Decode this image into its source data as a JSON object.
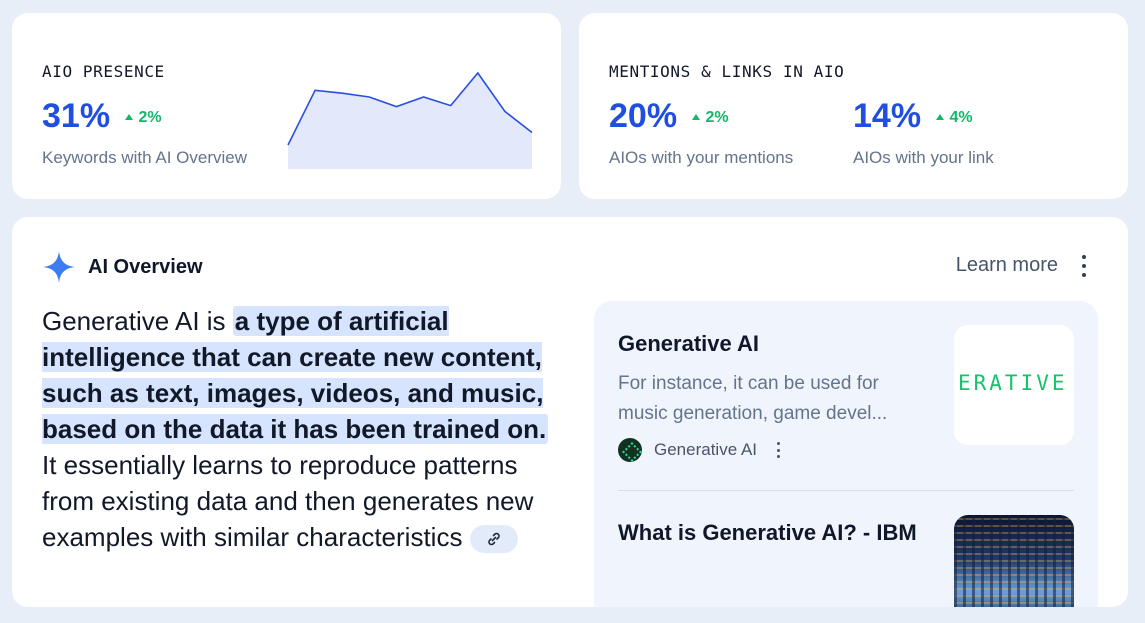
{
  "presence": {
    "title": "AIO PRESENCE",
    "value": "31%",
    "delta": "2%",
    "caption": "Keywords with AI Overview",
    "sparkline": [
      0.25,
      0.82,
      0.79,
      0.75,
      0.65,
      0.75,
      0.66,
      1.0,
      0.6,
      0.38
    ]
  },
  "mentions": {
    "title": "MENTIONS & LINKS IN AIO",
    "mentions_value": "20%",
    "mentions_delta": "2%",
    "mentions_caption": "AIOs with your mentions",
    "links_value": "14%",
    "links_delta": "4%",
    "links_caption": "AIOs with your link"
  },
  "overview": {
    "label": "AI Overview",
    "learn_more": "Learn more",
    "text_intro": "Generative AI is ",
    "text_highlight": "a type of artificial intelligence that can create new content, such as text, images, videos, and music, based on the data it has been trained on.",
    "text_rest": " It essentially learns to reproduce patterns from existing data and then generates new examples with similar characteristics",
    "sources": [
      {
        "title": "Generative AI",
        "description": "For instance, it can be used for music generation, game devel...",
        "site": "Generative AI",
        "thumb_text": "ERATIVE"
      },
      {
        "title": "What is Generative AI? - IBM"
      }
    ]
  },
  "colors": {
    "accent": "#1f4ee0",
    "positive": "#12b76a",
    "highlight": "#d6e4ff"
  }
}
